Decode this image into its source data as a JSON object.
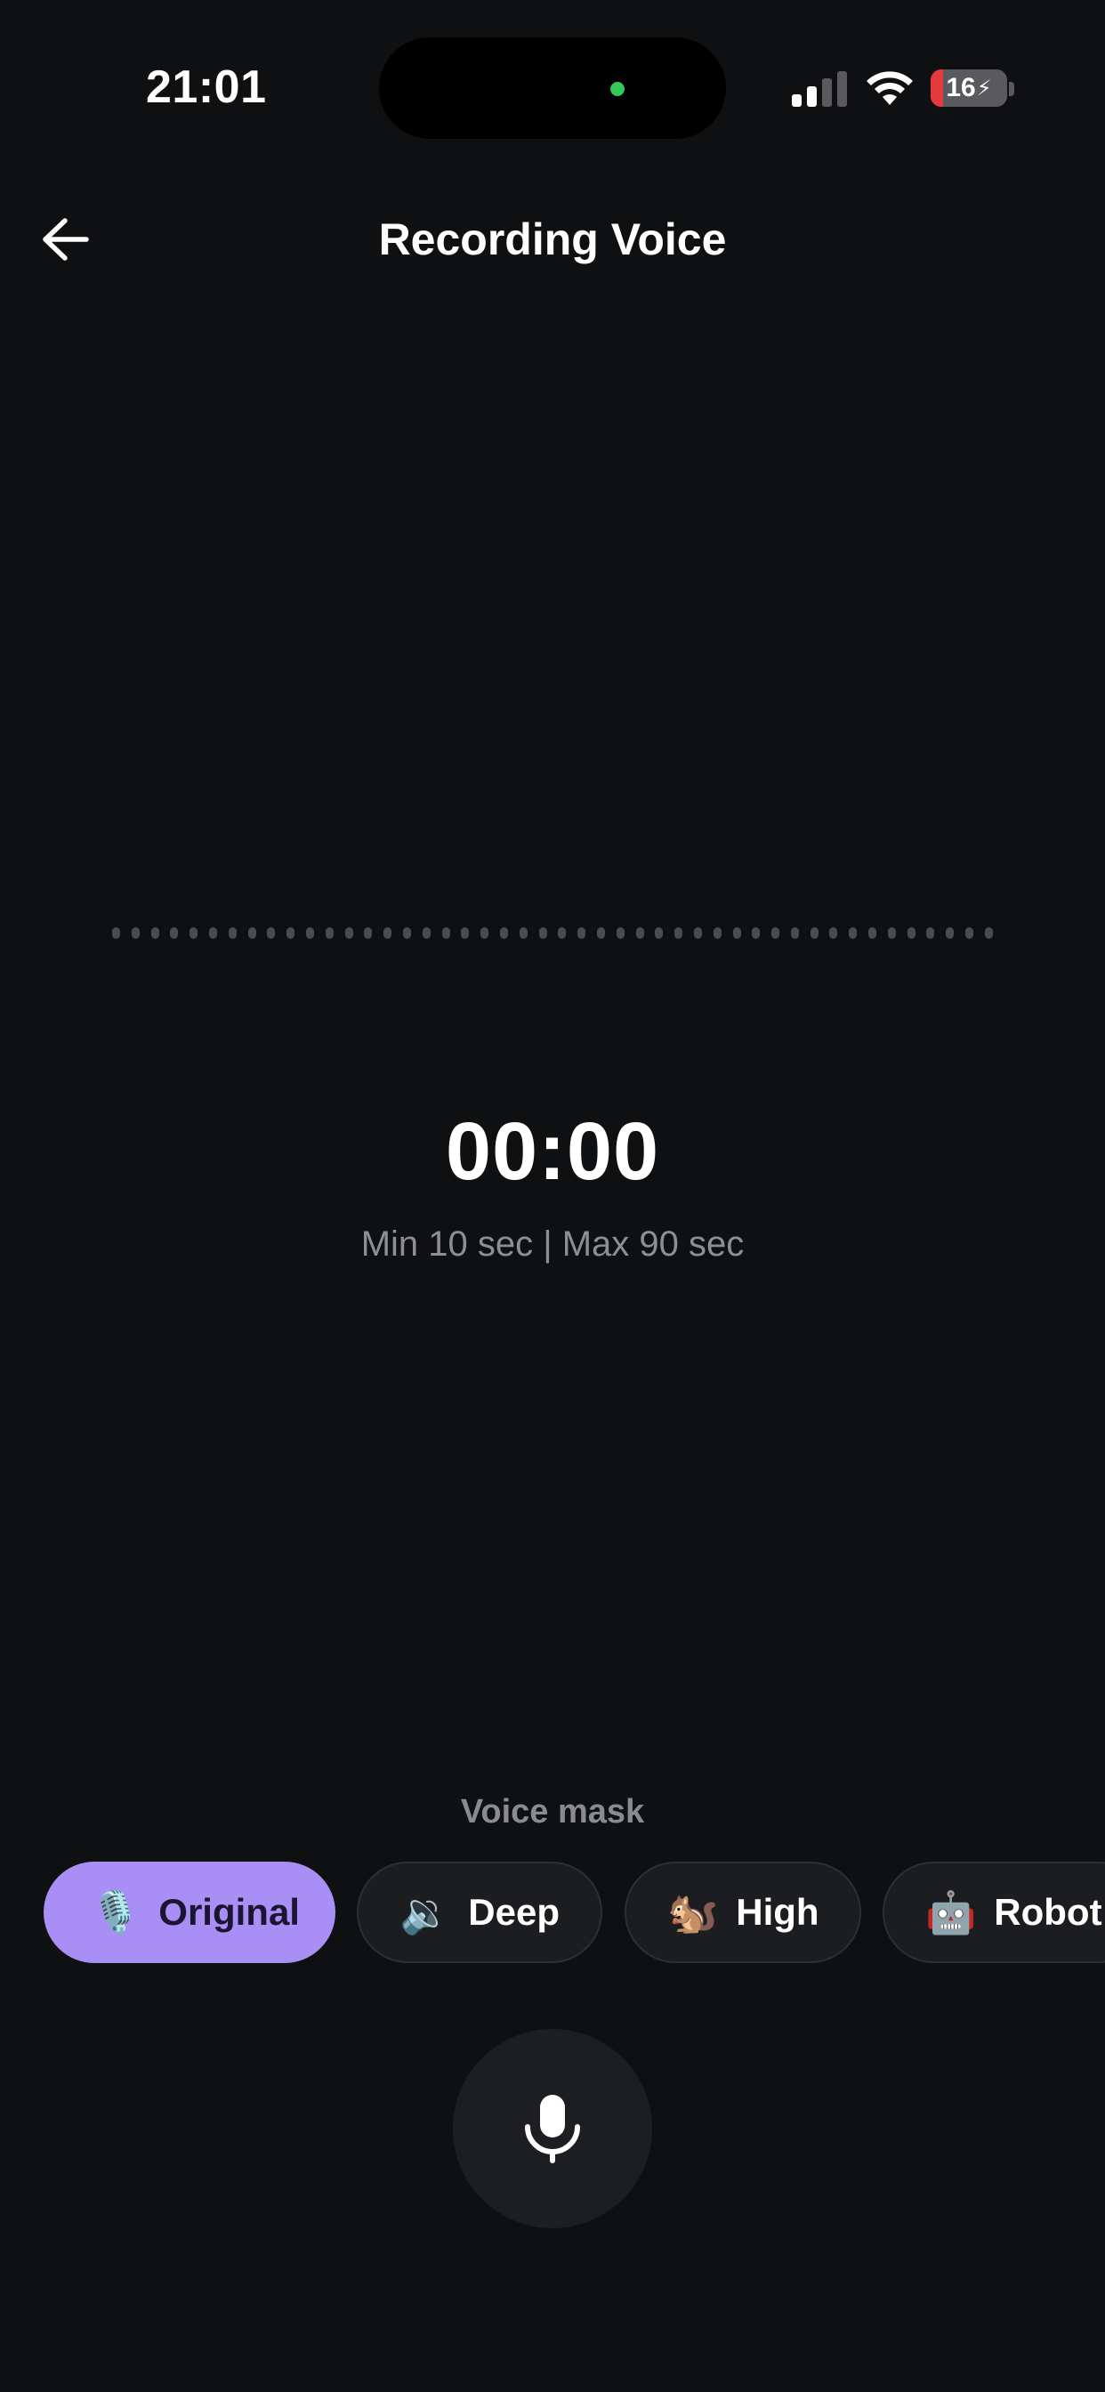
{
  "status_bar": {
    "time": "21:01",
    "battery_level": "16",
    "battery_fraction": 0.16,
    "battery_color": "#e5393b",
    "island_indicator_color": "#34c759"
  },
  "header": {
    "back_icon": "arrow-left-icon",
    "title": "Recording Voice"
  },
  "recording": {
    "timer": "00:00",
    "limits": "Min 10 sec | Max 90 sec",
    "waveform_dot_count": 46
  },
  "voice_mask": {
    "label": "Voice mask",
    "options": [
      {
        "label": "Original",
        "icon": "🎙️",
        "icon_name": "studio-microphone-icon",
        "selected": true
      },
      {
        "label": "Deep",
        "icon": "🔉",
        "icon_name": "speaker-icon",
        "selected": false
      },
      {
        "label": "High",
        "icon": "🐿️",
        "icon_name": "chipmunk-icon",
        "selected": false
      },
      {
        "label": "Robot",
        "icon": "🤖",
        "icon_name": "robot-icon",
        "selected": false
      }
    ]
  },
  "record_button": {
    "icon": "microphone-icon"
  },
  "colors": {
    "background": "#0f1012",
    "accent": "#a98ff5",
    "muted_text": "#8e8f94"
  }
}
